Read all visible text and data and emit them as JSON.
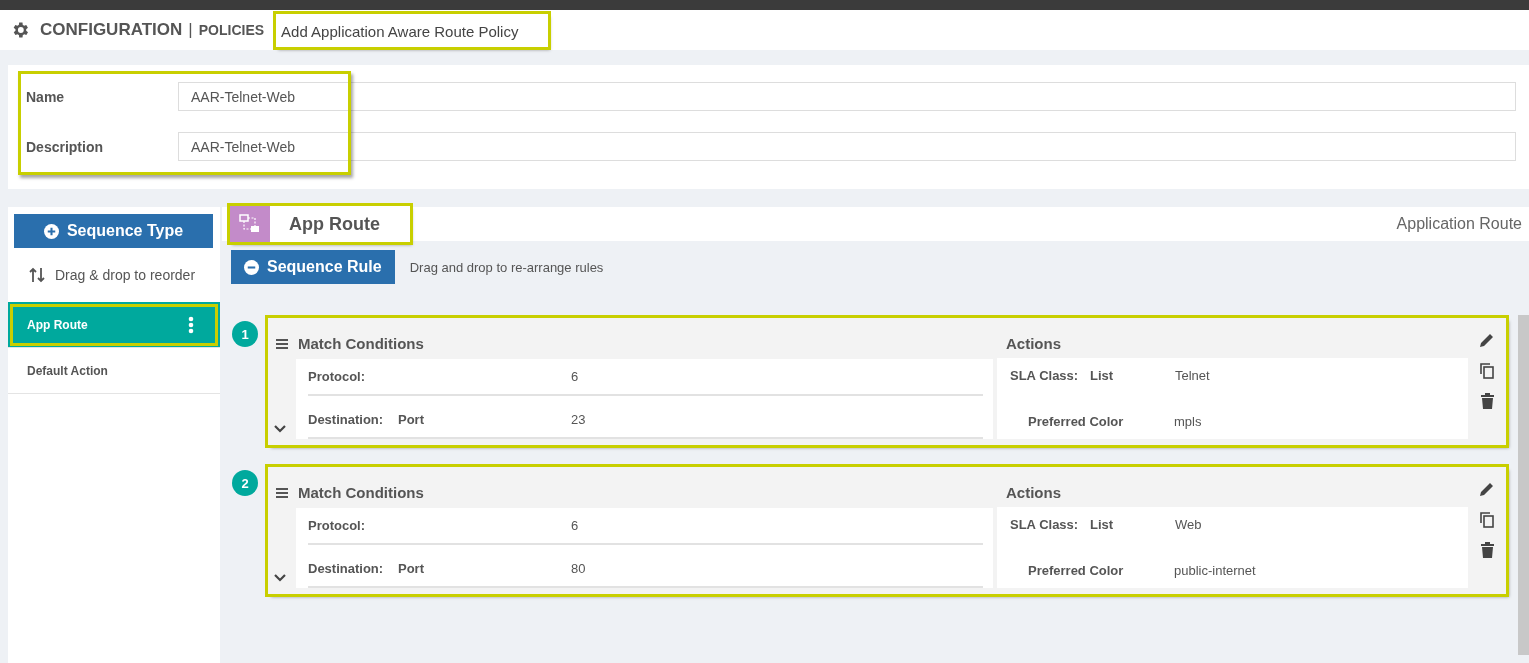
{
  "header": {
    "section": "CONFIGURATION",
    "separator": "|",
    "subsection": "POLICIES",
    "title": "Add Application Aware Route Policy",
    "title_highlighted": true
  },
  "form": {
    "highlighted": true,
    "fields": [
      {
        "label": "Name",
        "value": "AAR-Telnet-Web"
      },
      {
        "label": "Description",
        "value": "AAR-Telnet-Web"
      }
    ]
  },
  "sidebar": {
    "add_button": "Sequence Type",
    "reorder_hint": "Drag & drop to reorder",
    "items": [
      {
        "label": "App Route",
        "selected": true,
        "highlighted": true
      },
      {
        "label": "Default Action",
        "selected": false,
        "highlighted": false
      }
    ]
  },
  "sequence": {
    "tab": "App Route",
    "tab_highlighted": true,
    "type_label": "Application Route",
    "add_rule_button": "Sequence Rule",
    "rule_hint": "Drag and drop to re-arrange rules",
    "rules": [
      {
        "number": "1",
        "highlighted": true,
        "match_title": "Match Conditions",
        "match": [
          {
            "label": "Protocol:",
            "value": "6"
          },
          {
            "label": "Destination:",
            "qualifier": "Port",
            "value": "23"
          }
        ],
        "actions_title": "Actions",
        "actions": [
          {
            "kind": "primary",
            "label": "SLA Class:",
            "qualifier": "List",
            "value": "Telnet"
          },
          {
            "kind": "nested",
            "label": "Preferred Color",
            "value": "mpls"
          }
        ]
      },
      {
        "number": "2",
        "highlighted": true,
        "match_title": "Match Conditions",
        "match": [
          {
            "label": "Protocol:",
            "value": "6"
          },
          {
            "label": "Destination:",
            "qualifier": "Port",
            "value": "80"
          }
        ],
        "actions_title": "Actions",
        "actions": [
          {
            "kind": "primary",
            "label": "SLA Class:",
            "qualifier": "List",
            "value": "Web"
          },
          {
            "kind": "nested",
            "label": "Preferred Color",
            "value": "public-internet"
          }
        ]
      }
    ]
  }
}
